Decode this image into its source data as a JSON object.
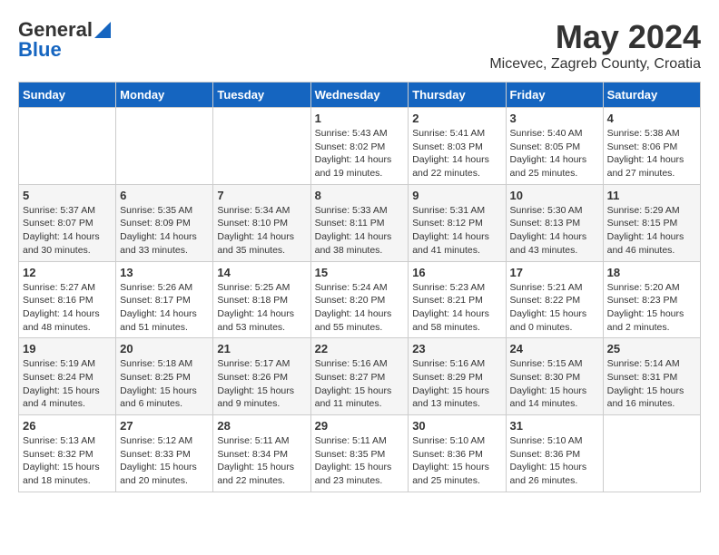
{
  "logo": {
    "general": "General",
    "blue": "Blue"
  },
  "title": {
    "month": "May 2024",
    "location": "Micevec, Zagreb County, Croatia"
  },
  "weekdays": [
    "Sunday",
    "Monday",
    "Tuesday",
    "Wednesday",
    "Thursday",
    "Friday",
    "Saturday"
  ],
  "weeks": [
    [
      {
        "day": "",
        "info": ""
      },
      {
        "day": "",
        "info": ""
      },
      {
        "day": "",
        "info": ""
      },
      {
        "day": "1",
        "info": "Sunrise: 5:43 AM\nSunset: 8:02 PM\nDaylight: 14 hours\nand 19 minutes."
      },
      {
        "day": "2",
        "info": "Sunrise: 5:41 AM\nSunset: 8:03 PM\nDaylight: 14 hours\nand 22 minutes."
      },
      {
        "day": "3",
        "info": "Sunrise: 5:40 AM\nSunset: 8:05 PM\nDaylight: 14 hours\nand 25 minutes."
      },
      {
        "day": "4",
        "info": "Sunrise: 5:38 AM\nSunset: 8:06 PM\nDaylight: 14 hours\nand 27 minutes."
      }
    ],
    [
      {
        "day": "5",
        "info": "Sunrise: 5:37 AM\nSunset: 8:07 PM\nDaylight: 14 hours\nand 30 minutes."
      },
      {
        "day": "6",
        "info": "Sunrise: 5:35 AM\nSunset: 8:09 PM\nDaylight: 14 hours\nand 33 minutes."
      },
      {
        "day": "7",
        "info": "Sunrise: 5:34 AM\nSunset: 8:10 PM\nDaylight: 14 hours\nand 35 minutes."
      },
      {
        "day": "8",
        "info": "Sunrise: 5:33 AM\nSunset: 8:11 PM\nDaylight: 14 hours\nand 38 minutes."
      },
      {
        "day": "9",
        "info": "Sunrise: 5:31 AM\nSunset: 8:12 PM\nDaylight: 14 hours\nand 41 minutes."
      },
      {
        "day": "10",
        "info": "Sunrise: 5:30 AM\nSunset: 8:13 PM\nDaylight: 14 hours\nand 43 minutes."
      },
      {
        "day": "11",
        "info": "Sunrise: 5:29 AM\nSunset: 8:15 PM\nDaylight: 14 hours\nand 46 minutes."
      }
    ],
    [
      {
        "day": "12",
        "info": "Sunrise: 5:27 AM\nSunset: 8:16 PM\nDaylight: 14 hours\nand 48 minutes."
      },
      {
        "day": "13",
        "info": "Sunrise: 5:26 AM\nSunset: 8:17 PM\nDaylight: 14 hours\nand 51 minutes."
      },
      {
        "day": "14",
        "info": "Sunrise: 5:25 AM\nSunset: 8:18 PM\nDaylight: 14 hours\nand 53 minutes."
      },
      {
        "day": "15",
        "info": "Sunrise: 5:24 AM\nSunset: 8:20 PM\nDaylight: 14 hours\nand 55 minutes."
      },
      {
        "day": "16",
        "info": "Sunrise: 5:23 AM\nSunset: 8:21 PM\nDaylight: 14 hours\nand 58 minutes."
      },
      {
        "day": "17",
        "info": "Sunrise: 5:21 AM\nSunset: 8:22 PM\nDaylight: 15 hours\nand 0 minutes."
      },
      {
        "day": "18",
        "info": "Sunrise: 5:20 AM\nSunset: 8:23 PM\nDaylight: 15 hours\nand 2 minutes."
      }
    ],
    [
      {
        "day": "19",
        "info": "Sunrise: 5:19 AM\nSunset: 8:24 PM\nDaylight: 15 hours\nand 4 minutes."
      },
      {
        "day": "20",
        "info": "Sunrise: 5:18 AM\nSunset: 8:25 PM\nDaylight: 15 hours\nand 6 minutes."
      },
      {
        "day": "21",
        "info": "Sunrise: 5:17 AM\nSunset: 8:26 PM\nDaylight: 15 hours\nand 9 minutes."
      },
      {
        "day": "22",
        "info": "Sunrise: 5:16 AM\nSunset: 8:27 PM\nDaylight: 15 hours\nand 11 minutes."
      },
      {
        "day": "23",
        "info": "Sunrise: 5:16 AM\nSunset: 8:29 PM\nDaylight: 15 hours\nand 13 minutes."
      },
      {
        "day": "24",
        "info": "Sunrise: 5:15 AM\nSunset: 8:30 PM\nDaylight: 15 hours\nand 14 minutes."
      },
      {
        "day": "25",
        "info": "Sunrise: 5:14 AM\nSunset: 8:31 PM\nDaylight: 15 hours\nand 16 minutes."
      }
    ],
    [
      {
        "day": "26",
        "info": "Sunrise: 5:13 AM\nSunset: 8:32 PM\nDaylight: 15 hours\nand 18 minutes."
      },
      {
        "day": "27",
        "info": "Sunrise: 5:12 AM\nSunset: 8:33 PM\nDaylight: 15 hours\nand 20 minutes."
      },
      {
        "day": "28",
        "info": "Sunrise: 5:11 AM\nSunset: 8:34 PM\nDaylight: 15 hours\nand 22 minutes."
      },
      {
        "day": "29",
        "info": "Sunrise: 5:11 AM\nSunset: 8:35 PM\nDaylight: 15 hours\nand 23 minutes."
      },
      {
        "day": "30",
        "info": "Sunrise: 5:10 AM\nSunset: 8:36 PM\nDaylight: 15 hours\nand 25 minutes."
      },
      {
        "day": "31",
        "info": "Sunrise: 5:10 AM\nSunset: 8:36 PM\nDaylight: 15 hours\nand 26 minutes."
      },
      {
        "day": "",
        "info": ""
      }
    ]
  ]
}
